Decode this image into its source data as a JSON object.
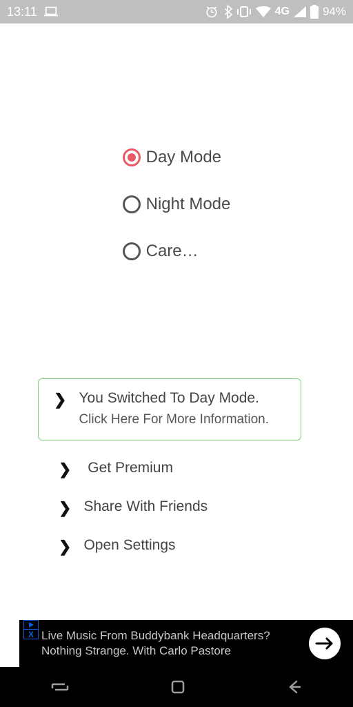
{
  "status": {
    "time": "13:11",
    "network": "4G",
    "battery": "94%"
  },
  "radios": {
    "day": {
      "label": "Day Mode",
      "selected": true
    },
    "night": {
      "label": "Night Mode",
      "selected": false
    },
    "care": {
      "label": "Care…",
      "selected": false
    }
  },
  "menu": {
    "notice": {
      "line1": "You Switched To Day Mode.",
      "line2": "Click Here For More Information."
    },
    "premium": " Get Premium ",
    "share": "Share With Friends",
    "settings": "Open Settings"
  },
  "ad": {
    "line1": "Live Music From Buddybank Headquarters?",
    "line2": "Nothing Strange. With Carlo Pastore",
    "close": "X"
  }
}
